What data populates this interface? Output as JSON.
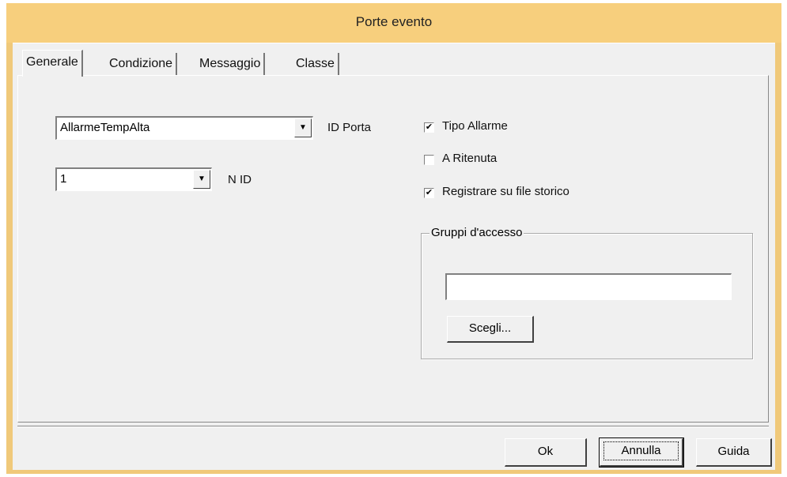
{
  "window": {
    "title": "Porte evento"
  },
  "tabs": [
    {
      "label": "Generale",
      "active": true
    },
    {
      "label": "Condizione",
      "active": false
    },
    {
      "label": "Messaggio",
      "active": false
    },
    {
      "label": "Classe",
      "active": false
    }
  ],
  "general": {
    "port_id": {
      "value": "AllarmeTempAlta",
      "label": "ID Porta"
    },
    "n_id": {
      "value": "1",
      "label": "N ID"
    },
    "checkboxes": [
      {
        "label": "Tipo Allarme",
        "checked": true
      },
      {
        "label": "A Ritenuta",
        "checked": false
      },
      {
        "label": "Registrare su file storico",
        "checked": true
      }
    ],
    "access_groups": {
      "legend": "Gruppi d'accesso",
      "value": "",
      "choose_label": "Scegli..."
    }
  },
  "footer": {
    "ok_label": "Ok",
    "cancel_label": "Annulla",
    "help_label": "Guida"
  },
  "colors": {
    "titlebar": "#f7cf7d",
    "dialog": "#f0f0f0"
  }
}
